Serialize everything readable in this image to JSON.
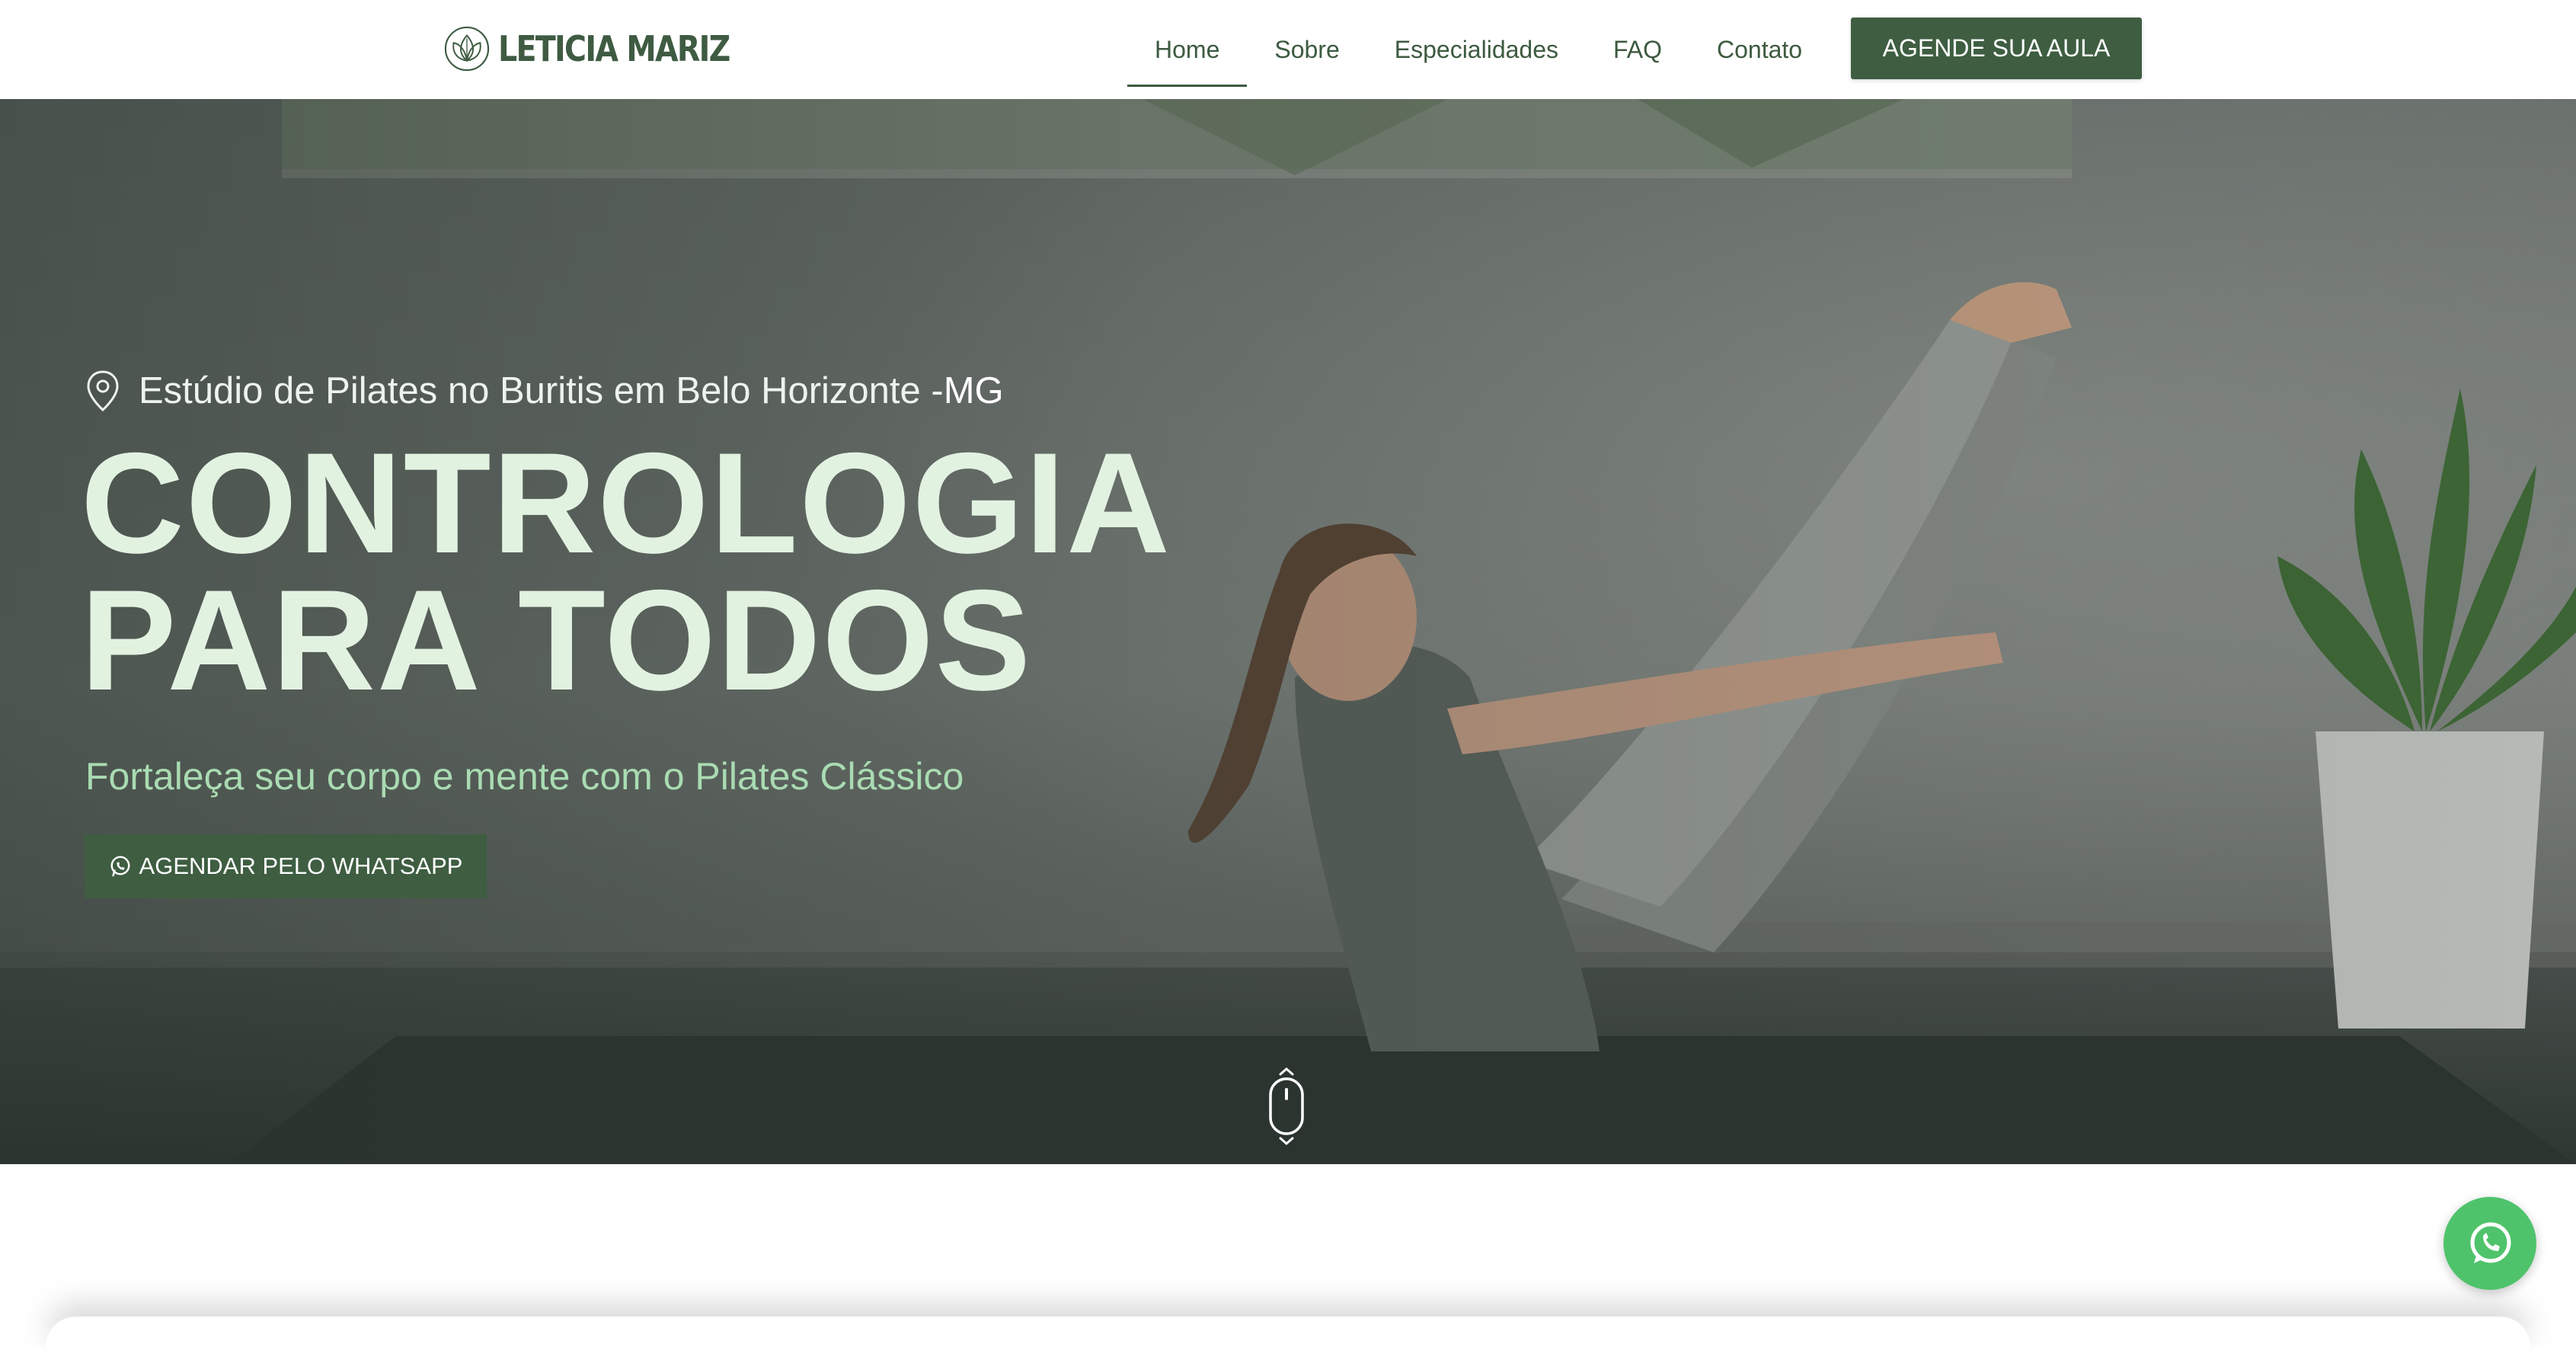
{
  "brand": {
    "name": "LETICIA MARIZ",
    "logo_icon": "lotus-flower-icon",
    "primary_color": "#3e5d41",
    "accent_text_color": "#a9dbb2",
    "headline_color": "#e2f2e1",
    "whatsapp_color": "#4fc36b"
  },
  "nav": {
    "items": [
      {
        "label": "Home",
        "active": true
      },
      {
        "label": "Sobre",
        "active": false
      },
      {
        "label": "Especialidades",
        "active": false
      },
      {
        "label": "FAQ",
        "active": false
      },
      {
        "label": "Contato",
        "active": false
      }
    ],
    "cta_label": "AGENDE SUA AULA"
  },
  "hero": {
    "location_icon": "map-pin-icon",
    "location_text": "Estúdio de Pilates no Buritis em Belo Horizonte - ",
    "location_state": "MG",
    "title_line1": "CONTROLOGIA",
    "title_line2": "PARA TODOS",
    "subtitle": "Fortaleça seu corpo e mente com o Pilates Clássico",
    "cta_icon": "whatsapp-icon",
    "cta_label": "AGENDAR PELO WHATSAPP",
    "scroll_icon": "mouse-scroll-icon"
  },
  "floating": {
    "icon": "whatsapp-icon"
  }
}
